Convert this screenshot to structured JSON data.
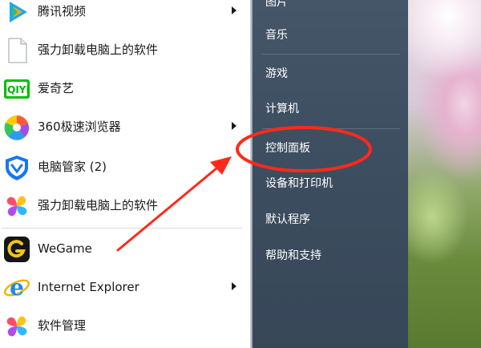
{
  "programs": [
    {
      "label": "腾讯视频",
      "icon": "tencent-video-icon",
      "has_submenu": true
    },
    {
      "label": "强力卸载电脑上的软件",
      "icon": "blank-file-icon",
      "has_submenu": false
    },
    {
      "label": "爱奇艺",
      "icon": "iqiyi-icon",
      "has_submenu": false
    },
    {
      "label": "360极速浏览器",
      "icon": "360-browser-icon",
      "has_submenu": true
    },
    {
      "label": "电脑管家 (2)",
      "icon": "pc-manager-shield-icon",
      "has_submenu": false
    },
    {
      "label": "强力卸载电脑上的软件",
      "icon": "colorful-petal-icon",
      "has_submenu": false
    },
    {
      "label": "WeGame",
      "icon": "wegame-icon",
      "has_submenu": false
    },
    {
      "label": "Internet Explorer",
      "icon": "internet-explorer-icon",
      "has_submenu": true
    },
    {
      "label": "软件管理",
      "icon": "colorful-petal-icon",
      "has_submenu": false
    }
  ],
  "right_links": {
    "pictures": "图片",
    "music": "音乐",
    "games": "游戏",
    "computer": "计算机",
    "control_panel": "控制面板",
    "devices_printers": "设备和打印机",
    "default_programs": "默认程序",
    "help_support": "帮助和支持"
  },
  "annotation": {
    "color": "#ff2a1a",
    "highlighted_item": "控制面板"
  },
  "colors": {
    "right_pane": "#3f5163",
    "wallpaper_pink": "#e6b2cf",
    "wallpaper_green": "#6a8a3c"
  }
}
